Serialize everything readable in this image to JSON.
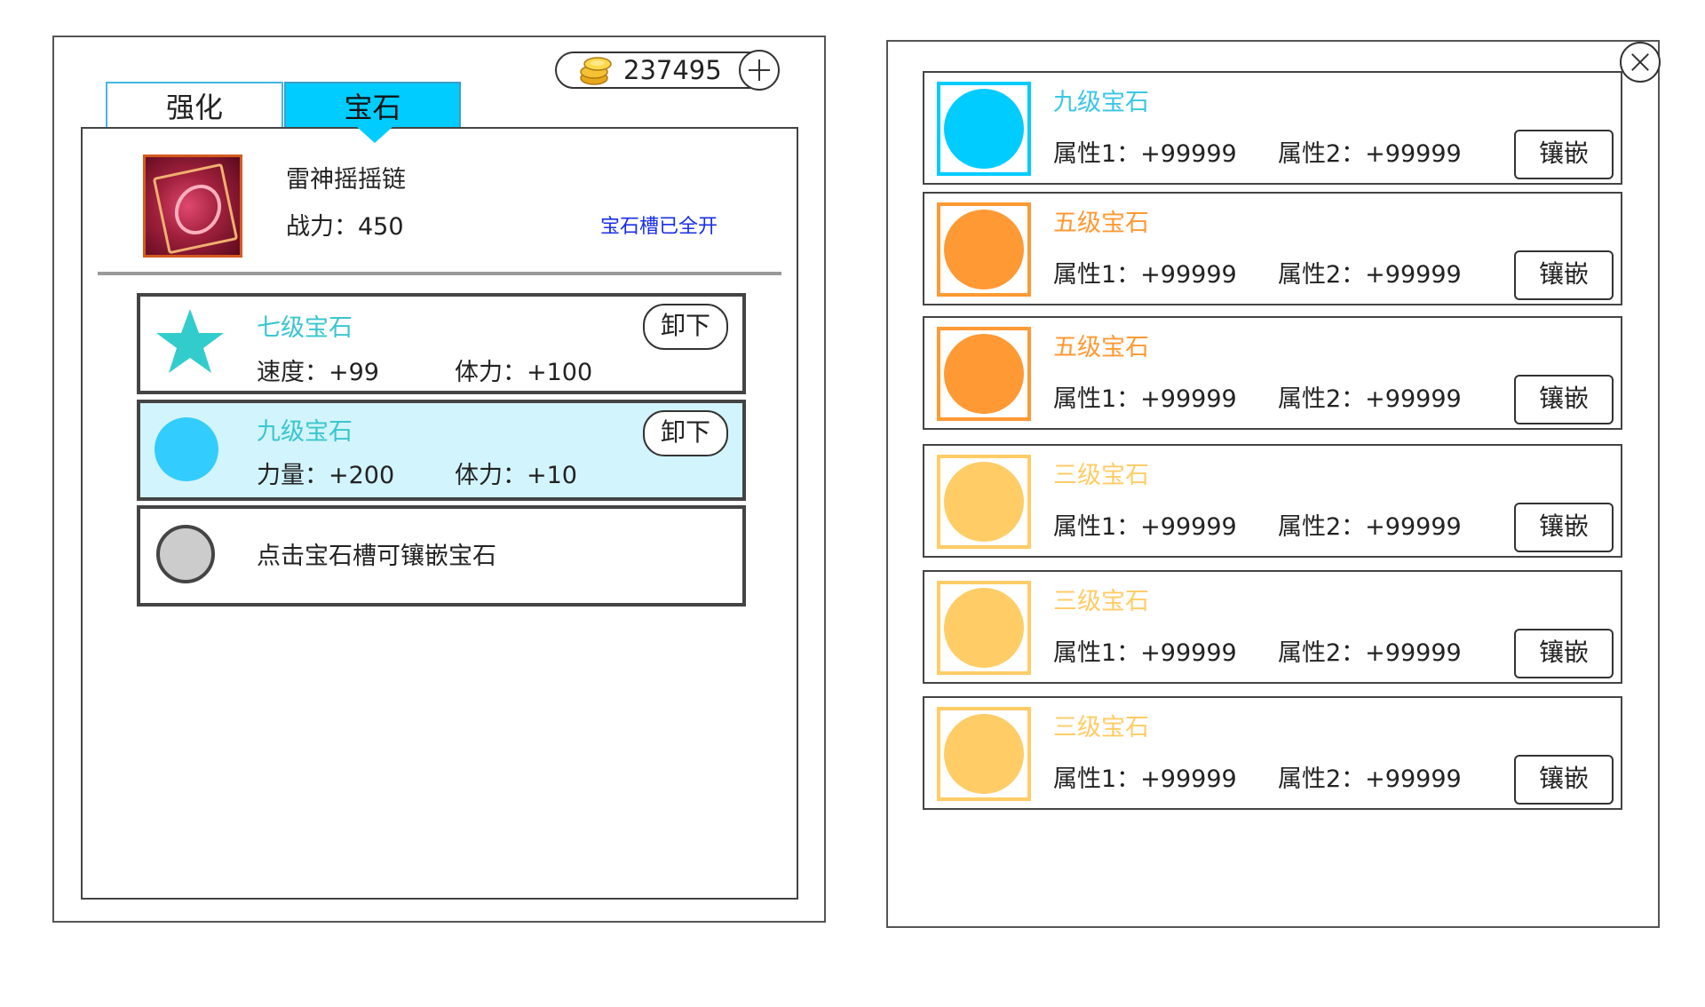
{
  "header": {
    "coins": "237495"
  },
  "tabs": [
    {
      "label": "强化"
    },
    {
      "label": "宝石"
    }
  ],
  "equipment": {
    "name": "雷神摇摇链",
    "power": "战力：450",
    "slot_status": "宝石槽已全开"
  },
  "equipped_slots": [
    {
      "title": "七级宝石",
      "icon": "star-icon",
      "color": "#33cccc",
      "attr1": "速度：+99",
      "attr2": "体力：+100",
      "action": "卸下"
    },
    {
      "title": "九级宝石",
      "icon": "circle-icon",
      "color": "#33ccff",
      "attr1": "力量：+200",
      "attr2": "体力：+10",
      "action": "卸下"
    },
    {
      "hint": "点击宝石槽可镶嵌宝石",
      "icon": "empty-slot-icon",
      "color": "#cccccc"
    }
  ],
  "gem_list": [
    {
      "name": "九级宝石",
      "color": "#00ccff",
      "name_color": "#39c6e6",
      "attr1": "属性1：+99999",
      "attr2": "属性2：+99999",
      "action": "镶嵌"
    },
    {
      "name": "五级宝石",
      "color": "#ff9933",
      "name_color": "#ff9933",
      "attr1": "属性1：+99999",
      "attr2": "属性2：+99999",
      "action": "镶嵌"
    },
    {
      "name": "五级宝石",
      "color": "#ff9933",
      "name_color": "#ff9933",
      "attr1": "属性1：+99999",
      "attr2": "属性2：+99999",
      "action": "镶嵌"
    },
    {
      "name": "三级宝石",
      "color": "#ffcc66",
      "name_color": "#ffcc66",
      "attr1": "属性1：+99999",
      "attr2": "属性2：+99999",
      "action": "镶嵌"
    },
    {
      "name": "三级宝石",
      "color": "#ffcc66",
      "name_color": "#ffcc66",
      "attr1": "属性1：+99999",
      "attr2": "属性2：+99999",
      "action": "镶嵌"
    },
    {
      "name": "三级宝石",
      "color": "#ffcc66",
      "name_color": "#ffcc66",
      "attr1": "属性1：+99999",
      "attr2": "属性2：+99999",
      "action": "镶嵌"
    }
  ]
}
